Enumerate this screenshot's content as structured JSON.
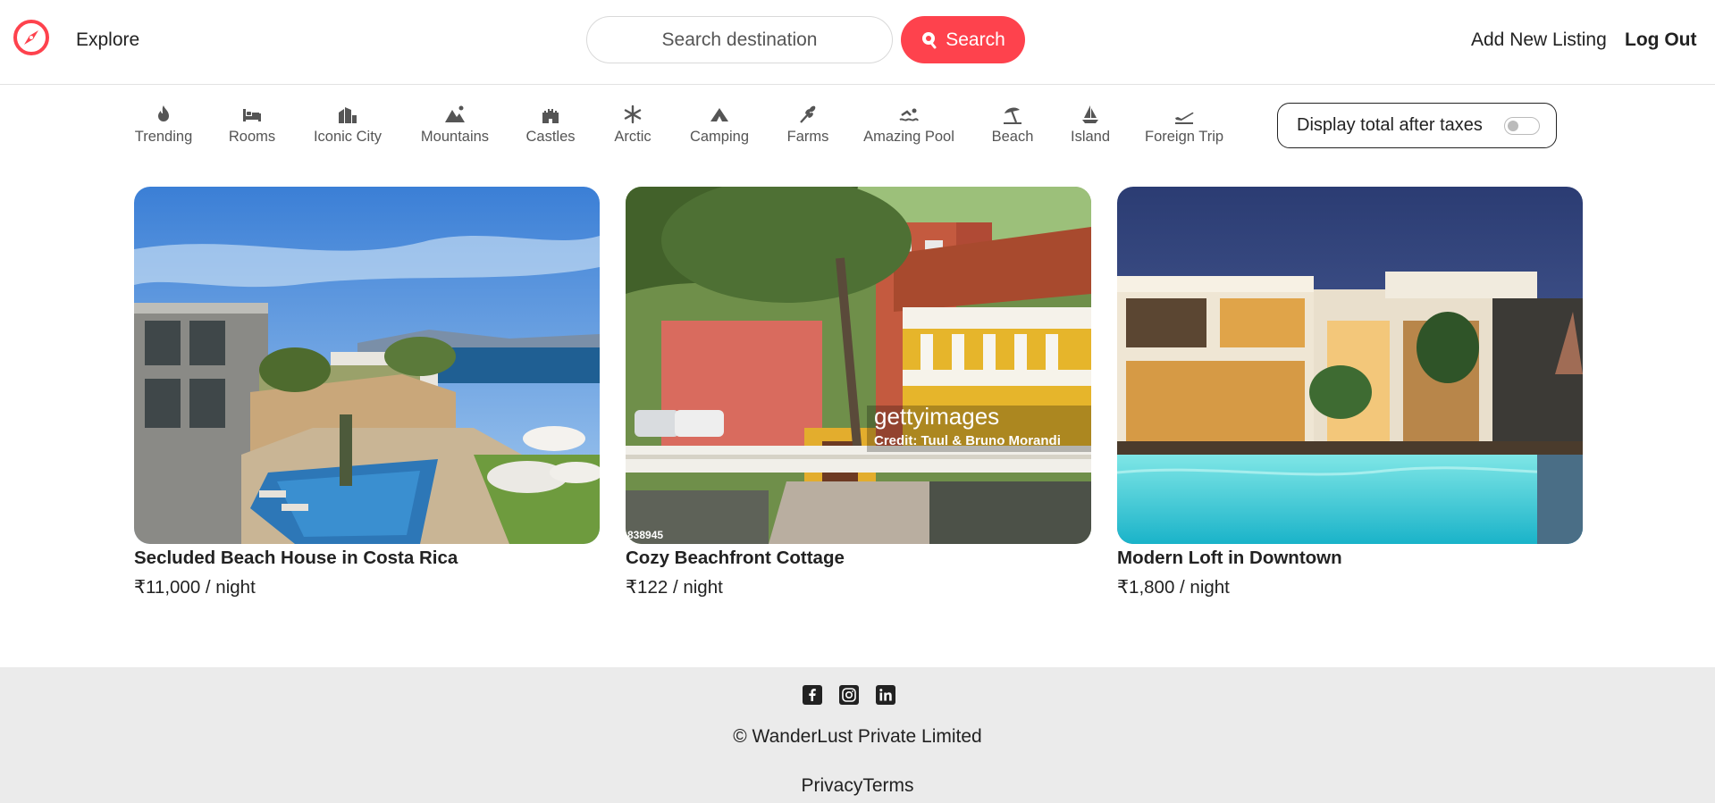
{
  "navbar": {
    "logo_icon": "compass-icon",
    "explore_label": "Explore",
    "search_placeholder": "Search destination",
    "search_button_label": "Search",
    "add_listing_label": "Add New Listing",
    "logout_label": "Log Out",
    "accent_color": "#fe424d"
  },
  "filters": [
    {
      "label": "Trending",
      "icon": "fire-icon"
    },
    {
      "label": "Rooms",
      "icon": "bed-icon"
    },
    {
      "label": "Iconic City",
      "icon": "city-icon"
    },
    {
      "label": "Mountains",
      "icon": "mountain-icon"
    },
    {
      "label": "Castles",
      "icon": "castle-icon"
    },
    {
      "label": "Arctic",
      "icon": "snowflake-icon"
    },
    {
      "label": "Camping",
      "icon": "campground-icon"
    },
    {
      "label": "Farms",
      "icon": "wheat-icon"
    },
    {
      "label": "Amazing Pool",
      "icon": "swimmer-icon"
    },
    {
      "label": "Beach",
      "icon": "umbrella-beach-icon"
    },
    {
      "label": "Island",
      "icon": "sailboat-icon"
    },
    {
      "label": "Foreign Trip",
      "icon": "plane-departure-icon"
    }
  ],
  "tax_toggle": {
    "label": "Display total after taxes",
    "enabled": false
  },
  "listings": [
    {
      "title": "Secluded Beach House in Costa Rica",
      "price": "₹11,000 / night"
    },
    {
      "title": "Cozy Beachfront Cottage",
      "price": "₹122 / night",
      "watermark": "gettyimages",
      "credit": "Credit: Tuul & Bruno Morandi",
      "image_id": "838945"
    },
    {
      "title": "Modern Loft in Downtown",
      "price": "₹1,800 / night"
    }
  ],
  "footer": {
    "social_icons": [
      "facebook-icon",
      "instagram-icon",
      "linkedin-icon"
    ],
    "copyright": "© WanderLust Private Limited",
    "privacy_label": "Privacy",
    "terms_label": "Terms"
  }
}
